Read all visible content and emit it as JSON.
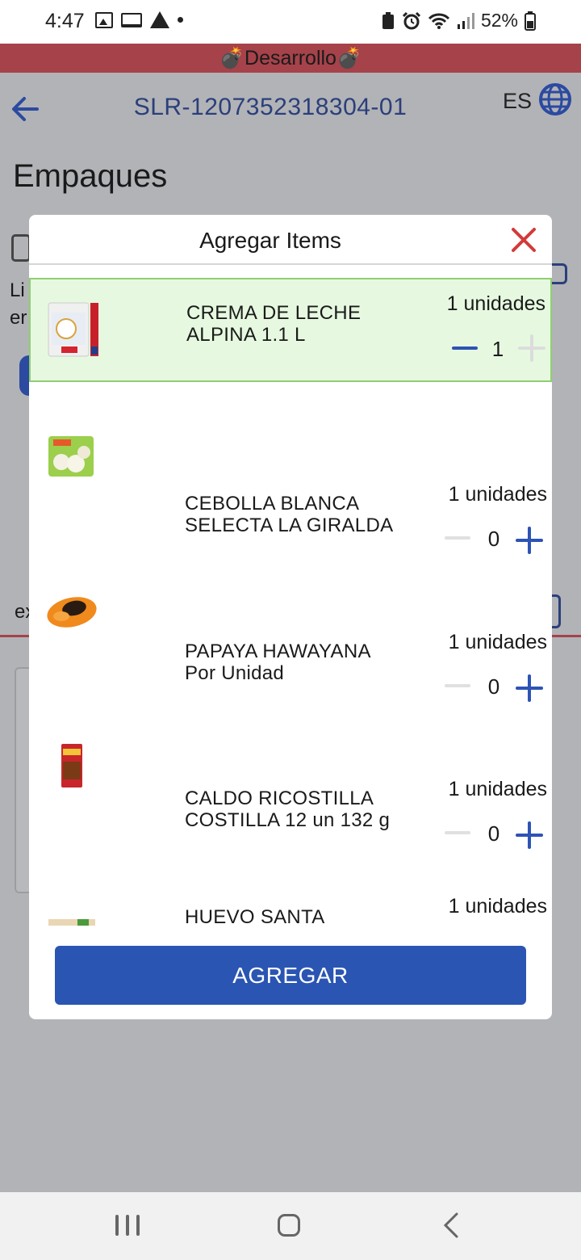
{
  "status_bar": {
    "time": "4:47",
    "battery": "52%"
  },
  "dev_banner": {
    "label": "💣Desarrollo💣"
  },
  "header": {
    "title": "SLR-1207352318304-01",
    "language": "ES"
  },
  "page": {
    "title": "Empaques",
    "fragment_1": "Li",
    "fragment_2": "er",
    "fragment_3": "ex"
  },
  "modal": {
    "title": "Agregar Items",
    "items": [
      {
        "name": "CREMA DE LECHE ALPINA 1.1 L",
        "units": "1 unidades",
        "quantity": "1",
        "selected": true,
        "icon": "cream-product-image"
      },
      {
        "name": "CEBOLLA BLANCA SELECTA LA GIRALDA",
        "units": "1 unidades",
        "quantity": "0",
        "selected": false,
        "icon": "onion-product-image"
      },
      {
        "name": "PAPAYA HAWAYANA Por Unidad",
        "units": "1 unidades",
        "quantity": "0",
        "selected": false,
        "icon": "papaya-product-image"
      },
      {
        "name": "CALDO RICOSTILLA COSTILLA 12 un 132 g",
        "units": "1 unidades",
        "quantity": "0",
        "selected": false,
        "icon": "broth-product-image"
      },
      {
        "name": "HUEVO SANTA",
        "units": "1 unidades",
        "quantity": "",
        "selected": false,
        "icon": "egg-product-image"
      }
    ],
    "add_button": "AGREGAR"
  },
  "colors": {
    "accent": "#2b55b2",
    "dev_banner": "#a6424a",
    "selected_bg": "#e6f9e0",
    "close": "#d33a3a"
  }
}
